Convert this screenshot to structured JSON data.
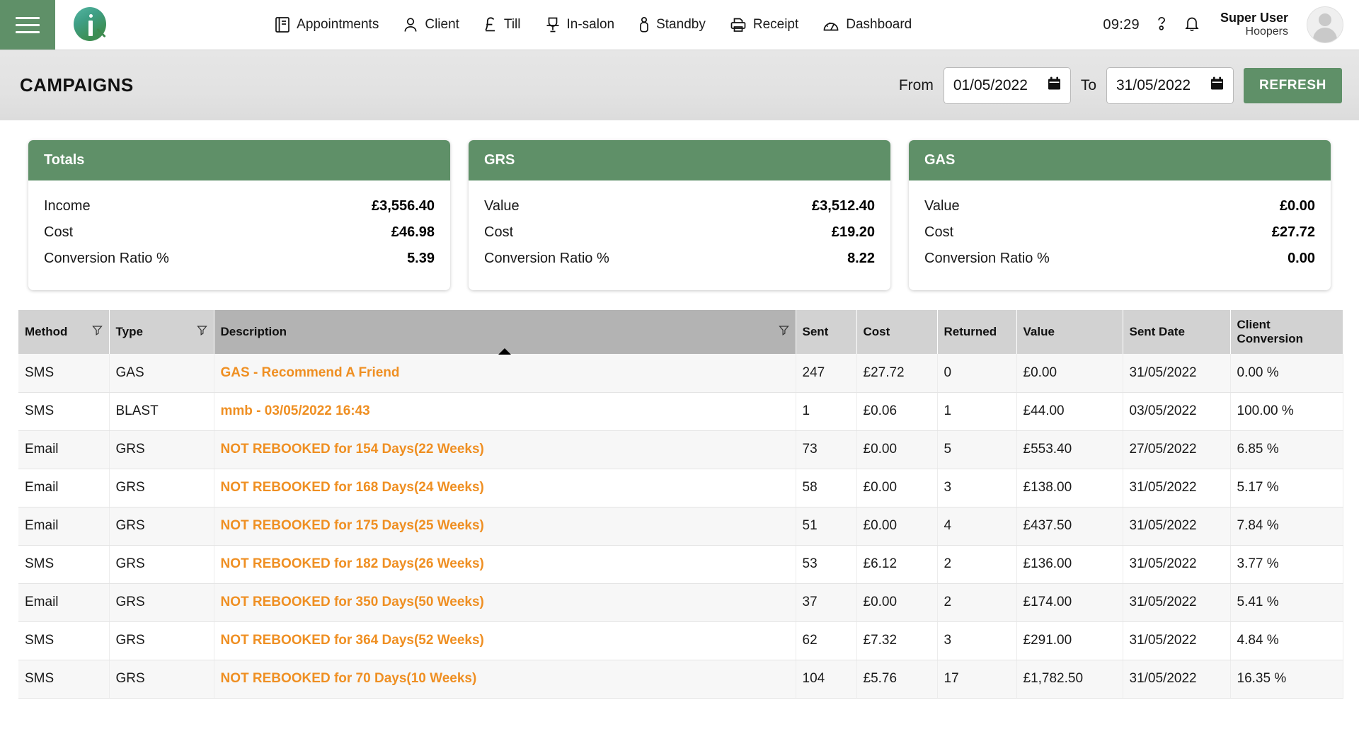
{
  "topnav": {
    "menu_icon": "hamburger-icon",
    "logo": "iq-logo",
    "items": [
      {
        "label": "Appointments",
        "icon": "book-icon"
      },
      {
        "label": "Client",
        "icon": "person-icon"
      },
      {
        "label": "Till",
        "icon": "pound-icon"
      },
      {
        "label": "In-salon",
        "icon": "salon-chair-icon"
      },
      {
        "label": "Standby",
        "icon": "standby-person-icon"
      },
      {
        "label": "Receipt",
        "icon": "printer-icon"
      },
      {
        "label": "Dashboard",
        "icon": "gauge-icon"
      }
    ],
    "time": "09:29",
    "help_icon": "question-mark-icon",
    "bell_icon": "bell-icon",
    "user_name": "Super User",
    "user_org": "Hoopers",
    "avatar": "user-avatar"
  },
  "subheader": {
    "title": "CAMPAIGNS",
    "from_label": "From",
    "from_value": "01/05/2022",
    "to_label": "To",
    "to_value": "31/05/2022",
    "calendar_icon": "calendar-icon",
    "refresh_label": "REFRESH"
  },
  "cards": [
    {
      "title": "Totals",
      "rows": [
        {
          "key": "Income",
          "value": "£3,556.40"
        },
        {
          "key": "Cost",
          "value": "£46.98"
        },
        {
          "key": "Conversion Ratio %",
          "value": "5.39"
        }
      ]
    },
    {
      "title": "GRS",
      "rows": [
        {
          "key": "Value",
          "value": "£3,512.40"
        },
        {
          "key": "Cost",
          "value": "£19.20"
        },
        {
          "key": "Conversion Ratio %",
          "value": "8.22"
        }
      ]
    },
    {
      "title": "GAS",
      "rows": [
        {
          "key": "Value",
          "value": "£0.00"
        },
        {
          "key": "Cost",
          "value": "£27.72"
        },
        {
          "key": "Conversion Ratio %",
          "value": "0.00"
        }
      ]
    }
  ],
  "table": {
    "columns": [
      {
        "label": "Method",
        "filter": true,
        "sorted": false
      },
      {
        "label": "Type",
        "filter": true,
        "sorted": false
      },
      {
        "label": "Description",
        "filter": true,
        "sorted": true
      },
      {
        "label": "Sent",
        "filter": false,
        "sorted": false
      },
      {
        "label": "Cost",
        "filter": false,
        "sorted": false
      },
      {
        "label": "Returned",
        "filter": false,
        "sorted": false
      },
      {
        "label": "Value",
        "filter": false,
        "sorted": false
      },
      {
        "label": "Sent Date",
        "filter": false,
        "sorted": false
      },
      {
        "label": "Client Conversion",
        "filter": false,
        "sorted": false
      }
    ],
    "sort_direction": "ascending",
    "rows": [
      {
        "method": "SMS",
        "type": "GAS",
        "description": "GAS - Recommend A Friend",
        "sent": "247",
        "cost": "£27.72",
        "returned": "0",
        "value": "£0.00",
        "sent_date": "31/05/2022",
        "conversion": "0.00 %"
      },
      {
        "method": "SMS",
        "type": "BLAST",
        "description": "mmb - 03/05/2022 16:43",
        "sent": "1",
        "cost": "£0.06",
        "returned": "1",
        "value": "£44.00",
        "sent_date": "03/05/2022",
        "conversion": "100.00 %"
      },
      {
        "method": "Email",
        "type": "GRS",
        "description": "NOT REBOOKED for 154 Days(22 Weeks)",
        "sent": "73",
        "cost": "£0.00",
        "returned": "5",
        "value": "£553.40",
        "sent_date": "27/05/2022",
        "conversion": "6.85 %"
      },
      {
        "method": "Email",
        "type": "GRS",
        "description": "NOT REBOOKED for 168 Days(24 Weeks)",
        "sent": "58",
        "cost": "£0.00",
        "returned": "3",
        "value": "£138.00",
        "sent_date": "31/05/2022",
        "conversion": "5.17 %"
      },
      {
        "method": "Email",
        "type": "GRS",
        "description": "NOT REBOOKED for 175 Days(25 Weeks)",
        "sent": "51",
        "cost": "£0.00",
        "returned": "4",
        "value": "£437.50",
        "sent_date": "31/05/2022",
        "conversion": "7.84 %"
      },
      {
        "method": "SMS",
        "type": "GRS",
        "description": "NOT REBOOKED for 182 Days(26 Weeks)",
        "sent": "53",
        "cost": "£6.12",
        "returned": "2",
        "value": "£136.00",
        "sent_date": "31/05/2022",
        "conversion": "3.77 %"
      },
      {
        "method": "Email",
        "type": "GRS",
        "description": "NOT REBOOKED for 350 Days(50 Weeks)",
        "sent": "37",
        "cost": "£0.00",
        "returned": "2",
        "value": "£174.00",
        "sent_date": "31/05/2022",
        "conversion": "5.41 %"
      },
      {
        "method": "SMS",
        "type": "GRS",
        "description": "NOT REBOOKED for 364 Days(52 Weeks)",
        "sent": "62",
        "cost": "£7.32",
        "returned": "3",
        "value": "£291.00",
        "sent_date": "31/05/2022",
        "conversion": "4.84 %"
      },
      {
        "method": "SMS",
        "type": "GRS",
        "description": "NOT REBOOKED for 70 Days(10 Weeks)",
        "sent": "104",
        "cost": "£5.76",
        "returned": "17",
        "value": "£1,782.50",
        "sent_date": "31/05/2022",
        "conversion": "16.35 %"
      }
    ]
  },
  "colors": {
    "brand_green": "#5f9068",
    "link_orange": "#ef8f22",
    "header_gray": "#d2d2d2",
    "sorted_gray": "#b3b3b3"
  }
}
